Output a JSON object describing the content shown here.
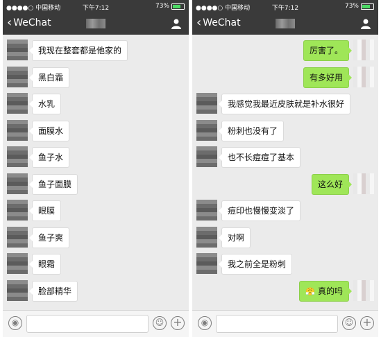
{
  "status": {
    "signal": "●●●●○ 中国移动",
    "time": "下午7:12",
    "battery": "73%",
    "battery_level": 0.73
  },
  "nav": {
    "back_label": "WeChat"
  },
  "left_messages": [
    {
      "side": "left",
      "text": "我现在整套都是他家的"
    },
    {
      "side": "left",
      "text": "黑白霜"
    },
    {
      "side": "left",
      "text": "水乳"
    },
    {
      "side": "left",
      "text": "面膜水"
    },
    {
      "side": "left",
      "text": "鱼子水"
    },
    {
      "side": "left",
      "text": "鱼子面膜"
    },
    {
      "side": "left",
      "text": "眼膜"
    },
    {
      "side": "left",
      "text": "鱼子爽"
    },
    {
      "side": "left",
      "text": "眼霜"
    },
    {
      "side": "left",
      "text": "脸部精华"
    }
  ],
  "right_messages": [
    {
      "side": "right",
      "text": "厉害了。"
    },
    {
      "side": "right",
      "text": "有多好用"
    },
    {
      "side": "left",
      "text": "我感觉我最近皮肤就是补水很好"
    },
    {
      "side": "left",
      "text": "粉刺也没有了"
    },
    {
      "side": "left",
      "text": "也不长痘痘了基本"
    },
    {
      "side": "right",
      "text": "这么好"
    },
    {
      "side": "left",
      "text": "痘印也慢慢变淡了"
    },
    {
      "side": "left",
      "text": "对啊"
    },
    {
      "side": "left",
      "text": "我之前全是粉刺"
    },
    {
      "side": "right",
      "text": "真的吗",
      "emoji": "😤"
    }
  ],
  "icons": {
    "voice": "voice-icon",
    "emoji": "emoji-icon",
    "plus": "plus-icon",
    "back": "chevron-left-icon",
    "profile": "person-icon"
  }
}
